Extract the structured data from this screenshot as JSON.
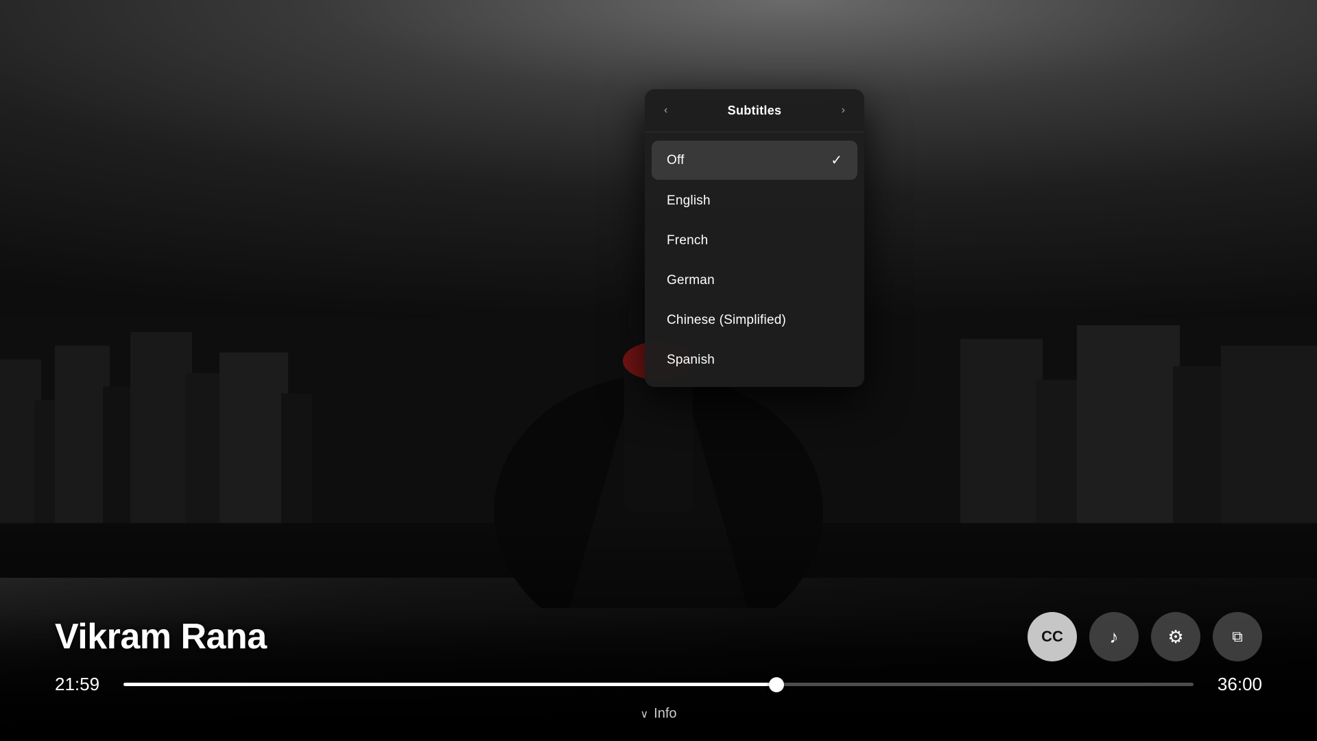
{
  "background": {
    "alt": "Superhero figure with cape standing against city skyline"
  },
  "subtitles_panel": {
    "title": "Subtitles",
    "nav_prev": "‹",
    "nav_next": "›",
    "items": [
      {
        "id": "off",
        "label": "Off",
        "selected": true
      },
      {
        "id": "english",
        "label": "English",
        "selected": false
      },
      {
        "id": "french",
        "label": "French",
        "selected": false
      },
      {
        "id": "german",
        "label": "German",
        "selected": false
      },
      {
        "id": "chinese-simplified",
        "label": "Chinese (Simplified)",
        "selected": false
      },
      {
        "id": "spanish",
        "label": "Spanish",
        "selected": false
      }
    ]
  },
  "player": {
    "movie_title": "Vikram Rana",
    "current_time": "21:59",
    "end_time": "36:00",
    "progress_percent": 61,
    "info_label": "Info",
    "controls": [
      {
        "id": "subtitles",
        "icon": "CC",
        "active": true
      },
      {
        "id": "audio",
        "icon": "♪",
        "active": false
      },
      {
        "id": "settings",
        "icon": "⚙",
        "active": false
      },
      {
        "id": "pip",
        "icon": "⧉",
        "active": false
      }
    ]
  }
}
